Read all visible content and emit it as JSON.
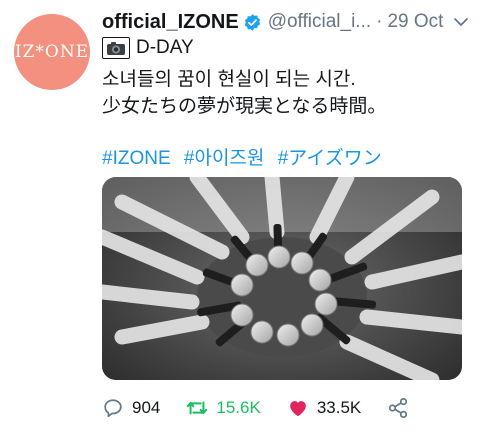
{
  "tweet": {
    "avatar_text": "IZ*ONE",
    "display_name": "official_IZONE",
    "handle": "@official_i...",
    "dot": "·",
    "date": "29 Oct",
    "text_line1": "D-DAY",
    "text_line2": "소녀들의 꿈이 현실이 되는 시간.",
    "text_line3": "少女たちの夢が現実となる時間。",
    "hashtags": [
      "#IZONE",
      "#아이즈원",
      "#アイズワン"
    ],
    "counts": {
      "replies": "904",
      "retweets": "15.6K",
      "likes": "33.5K"
    }
  },
  "colors": {
    "avatar_bg": "#f3907f",
    "link": "#1b95e0",
    "verified": "#1da1f2",
    "retweet": "#17bf63",
    "like": "#e0245e"
  },
  "icons": {
    "verified": "verified-badge-icon",
    "chevron": "chevron-down-icon",
    "camera": "camera-emoji-icon",
    "reply": "reply-icon",
    "retweet": "retweet-icon",
    "like": "heart-icon",
    "share": "share-icon"
  }
}
